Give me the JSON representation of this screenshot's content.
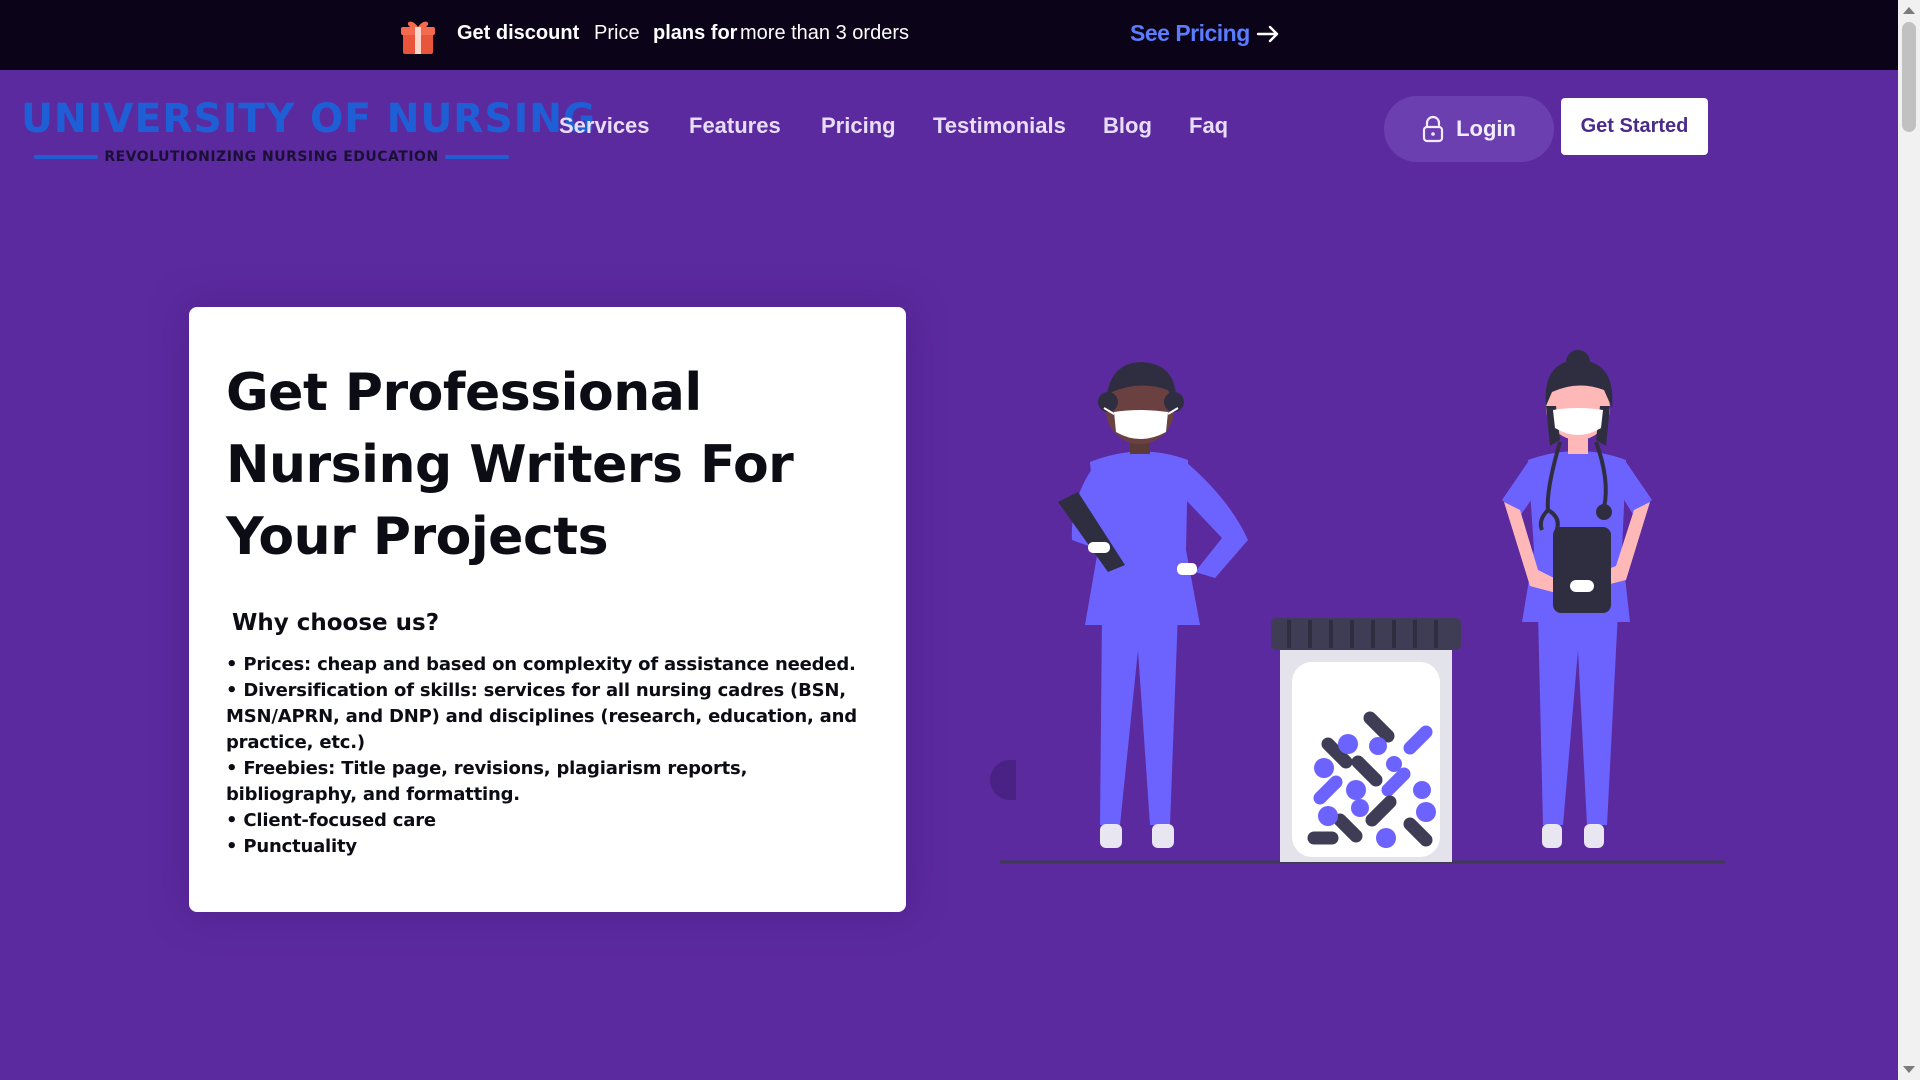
{
  "promo": {
    "text1": "Get discount",
    "text2": "Price",
    "text3": "plans for",
    "text4": "more than 3 orders",
    "link": "See Pricing"
  },
  "logo": {
    "name": "UNIVERSITY OF NURSING",
    "tagline": "REVOLUTIONIZING NURSING EDUCATION"
  },
  "nav": {
    "items": [
      "Services",
      "Features",
      "Pricing",
      "Testimonials",
      "Blog",
      "Faq"
    ],
    "login": "Login",
    "get_started": "Get Started"
  },
  "hero": {
    "title": "Get Professional Nursing Writers For Your Projects",
    "subtitle": "Why choose us?",
    "bullets": [
      "• Prices: cheap and based on complexity of assistance needed.",
      "• Diversification of skills: services for all nursing cadres (BSN, MSN/APRN, and DNP) and disciplines (research, education, and practice, etc.)",
      "• Freebies: Title page, revisions, plagiarism reports, bibliography, and formatting.",
      "• Client-focused care",
      "• Punctuality"
    ]
  },
  "colors": {
    "background": "#5b2a9f",
    "promo_bar": "#0b0318",
    "accent_link": "#5b7cff",
    "logo_blue": "#1f5fd6",
    "scrubs": "#6c63ff"
  },
  "icons": {
    "gift": "gift-icon",
    "arrow": "arrow-right-icon",
    "lock": "lock-icon"
  }
}
